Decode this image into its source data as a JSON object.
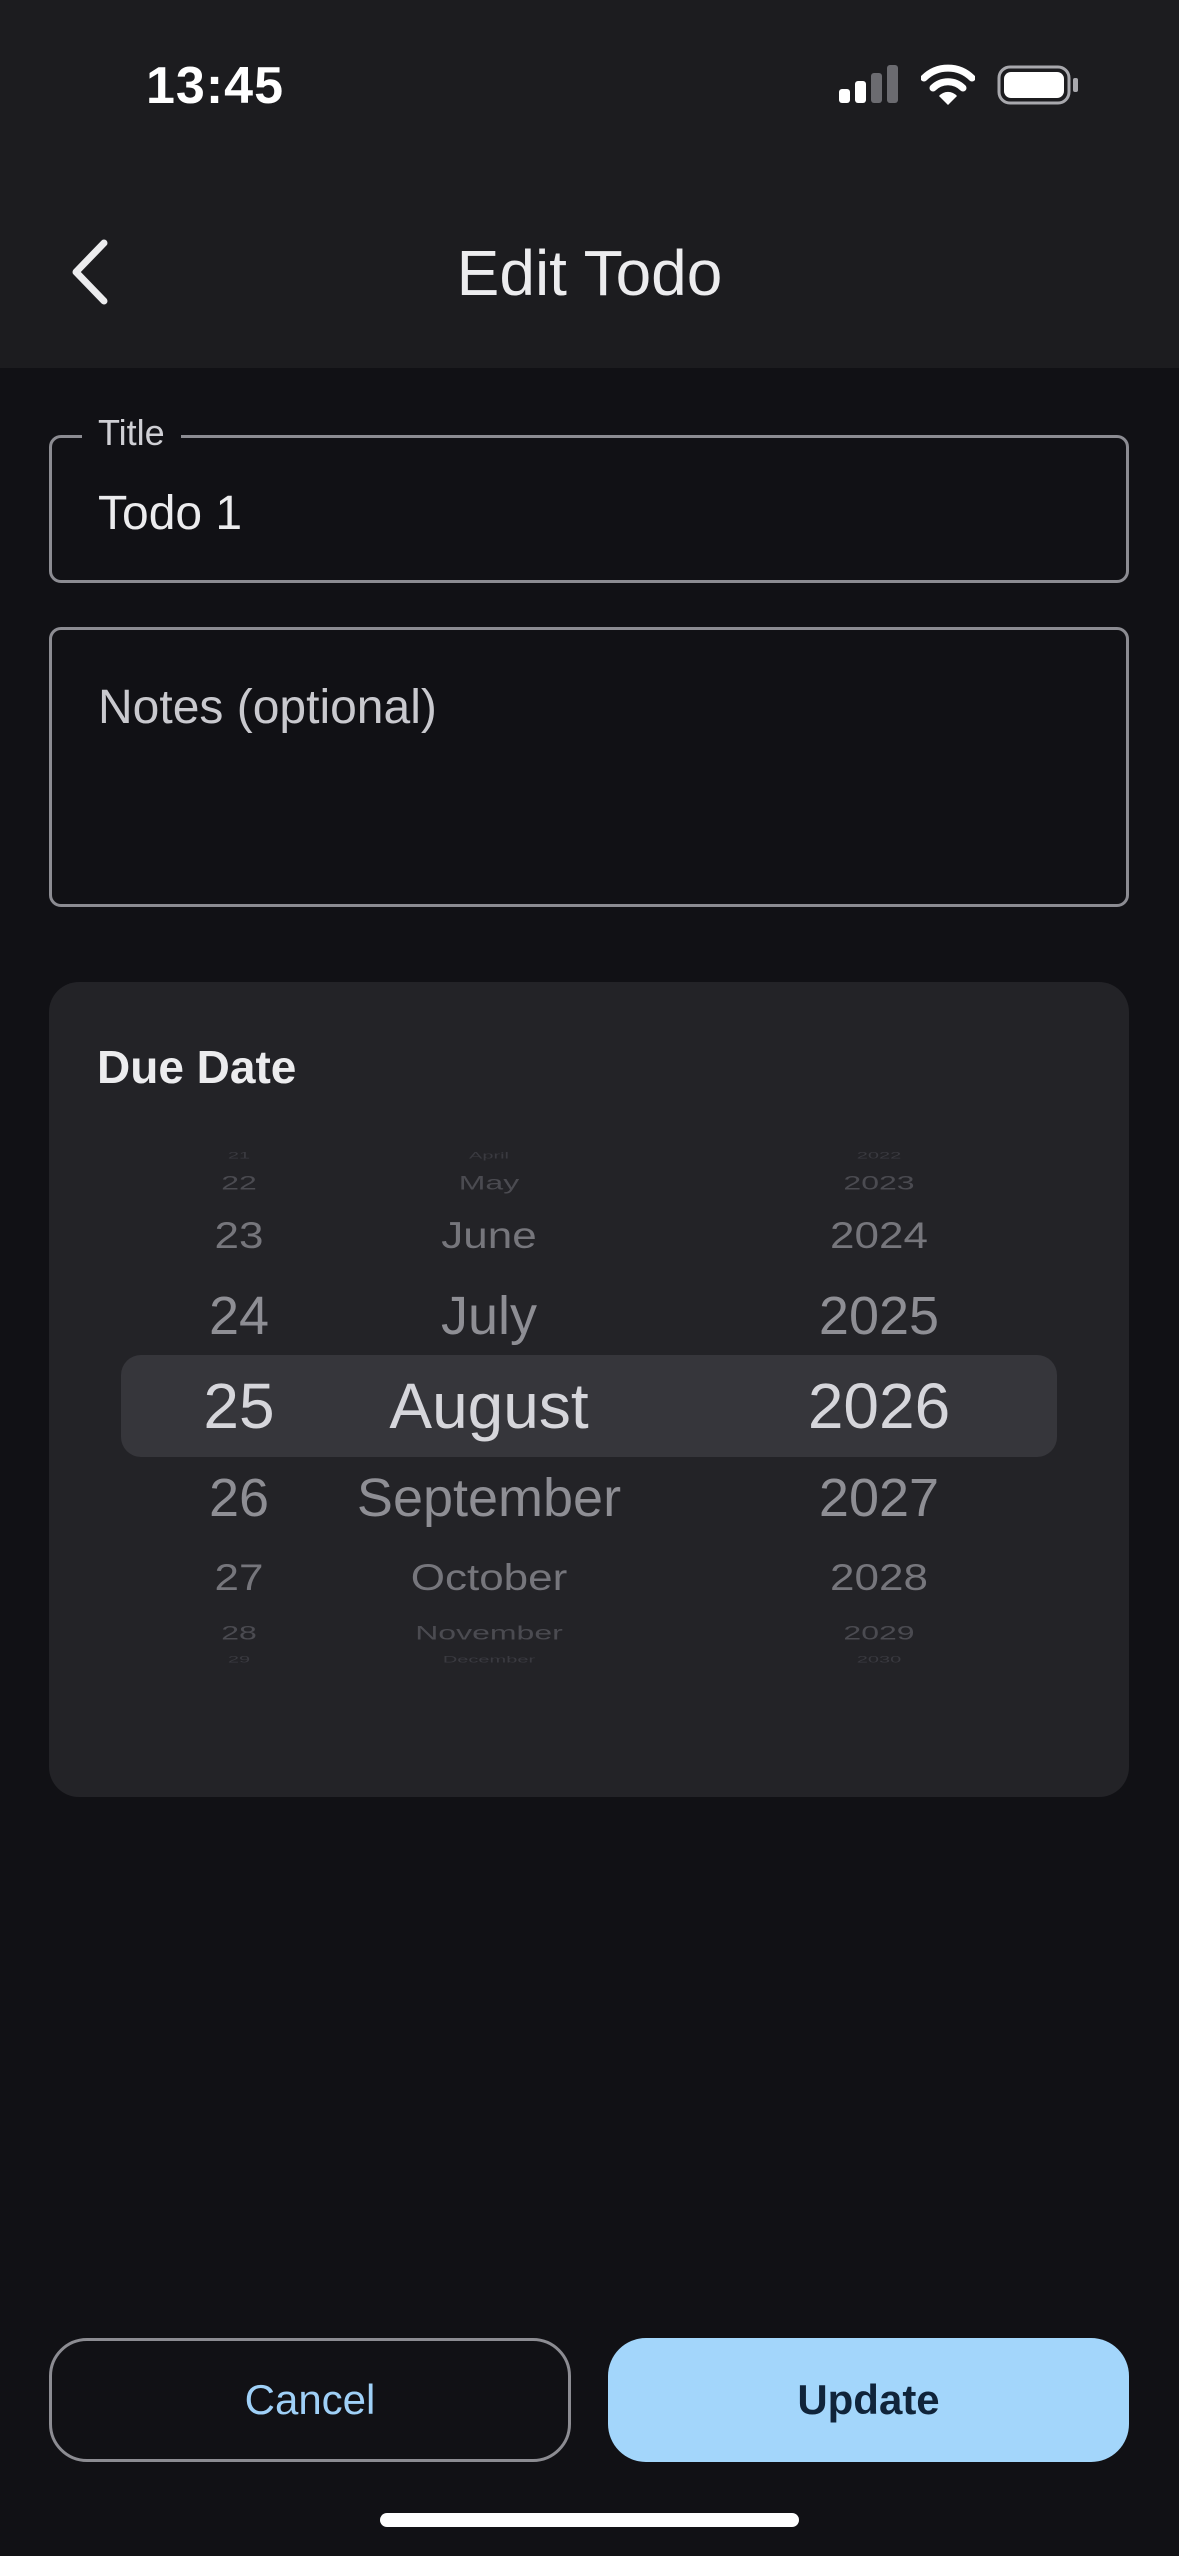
{
  "status_bar": {
    "time": "13:45",
    "icons": [
      "cellular-signal-icon",
      "wifi-icon",
      "battery-icon"
    ]
  },
  "app_bar": {
    "back_icon": "chevron-left-icon",
    "title": "Edit Todo"
  },
  "form": {
    "title_field": {
      "label": "Title",
      "value": "Todo 1"
    },
    "notes_field": {
      "placeholder": "Notes (optional)",
      "value": ""
    }
  },
  "due_date": {
    "label": "Due Date",
    "days": [
      "21",
      "22",
      "23",
      "24",
      "25",
      "26",
      "27",
      "28",
      "29"
    ],
    "months": [
      "April",
      "May",
      "June",
      "July",
      "August",
      "September",
      "October",
      "November",
      "December"
    ],
    "years": [
      "2022",
      "2023",
      "2024",
      "2025",
      "2026",
      "2027",
      "2028",
      "2029",
      "2030"
    ],
    "selected": {
      "day": "25",
      "month": "August",
      "year": "2026"
    }
  },
  "actions": {
    "cancel_label": "Cancel",
    "update_label": "Update"
  },
  "colors": {
    "background": "#111115",
    "app_bar": "#1c1c1f",
    "card": "#232327",
    "accent": "#a3d6fb",
    "accent_text": "#9fd0f7",
    "outline": "#8c8c92"
  }
}
